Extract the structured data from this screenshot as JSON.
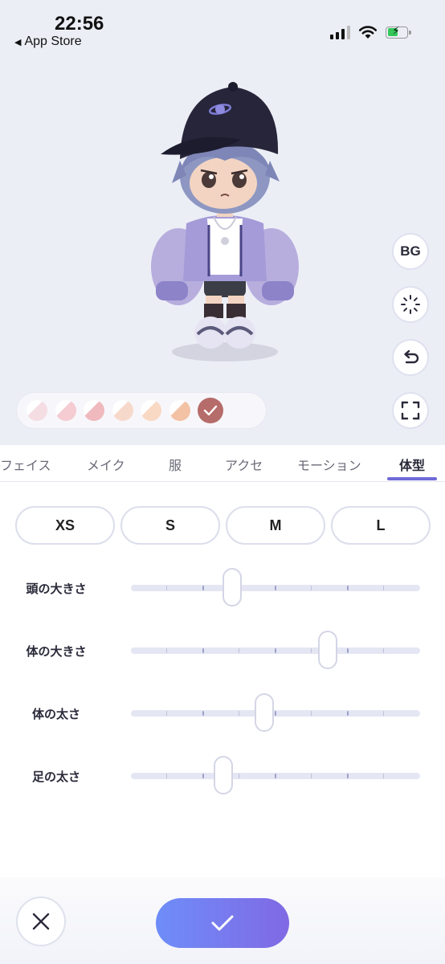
{
  "status_bar": {
    "time": "22:56",
    "back_label": "App Store",
    "back_arrow": "◀"
  },
  "right_buttons": {
    "bg_label": "BG",
    "animation_icon": "loading-sparkle-icon",
    "undo_icon": "undo-icon",
    "fullscreen_icon": "fullscreen-icon"
  },
  "palette": {
    "swatches": [
      "#f5dde4",
      "#f4ccd2",
      "#efb9bd",
      "#f7d9cc",
      "#f9d8c4",
      "#f3c2a4",
      "#b66c6a"
    ],
    "selected_index": 6
  },
  "tabs": [
    {
      "label": "フェイス",
      "active": false
    },
    {
      "label": "メイク",
      "active": false
    },
    {
      "label": "服",
      "active": false
    },
    {
      "label": "アクセ",
      "active": false
    },
    {
      "label": "モーション",
      "active": false
    },
    {
      "label": "体型",
      "active": true
    }
  ],
  "size_presets": [
    "XS",
    "S",
    "M",
    "L"
  ],
  "sliders": [
    {
      "label": "頭の大きさ",
      "value": 0.35
    },
    {
      "label": "体の大きさ",
      "value": 0.68
    },
    {
      "label": "体の太さ",
      "value": 0.46
    },
    {
      "label": "足の太さ",
      "value": 0.32
    }
  ],
  "colors": {
    "accent": "#6f6ad8",
    "confirm_gradient_start": "#6e8df8",
    "confirm_gradient_end": "#8069e4",
    "preview_background": "#eceef6"
  },
  "bottom": {
    "close_icon": "close-icon",
    "confirm_icon": "check-icon"
  }
}
